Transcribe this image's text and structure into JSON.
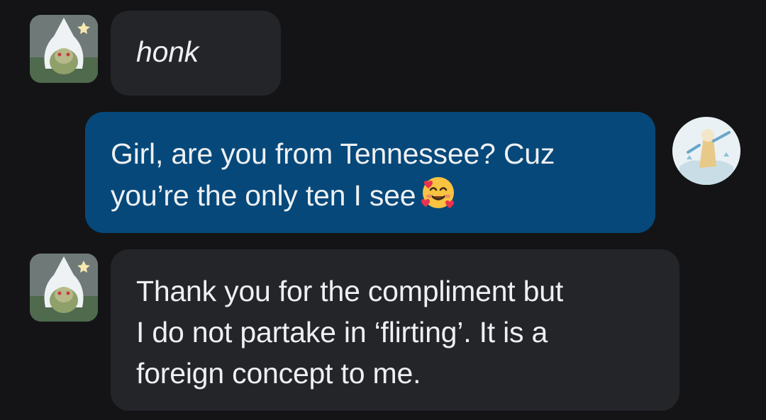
{
  "messages": [
    {
      "sender": "other",
      "avatar": "hooded-creature-avatar",
      "text": "honk",
      "style": "italic"
    },
    {
      "sender": "self",
      "avatar": "user-avatar",
      "text": "Girl, are you from Tennessee? Cuz\nyou’re the only ten I see",
      "emoji": "smiling-face-with-hearts-emoji"
    },
    {
      "sender": "other",
      "avatar": "hooded-creature-avatar",
      "text": "Thank you for the compliment but\nI do not partake in ‘flirting’. It is a\nforeign concept to me."
    }
  ],
  "colors": {
    "background": "#141416",
    "incoming_bubble": "#232529",
    "outgoing_bubble": "#06487a",
    "text": "#eef0f2"
  }
}
